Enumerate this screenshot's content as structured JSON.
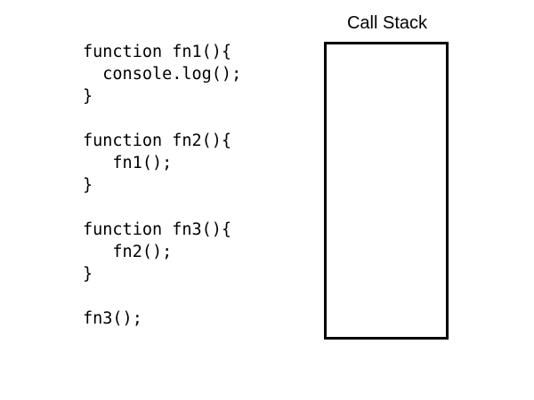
{
  "code": {
    "lines": [
      "function fn1(){",
      "  console.log();",
      "}",
      "",
      "function fn2(){",
      "   fn1();",
      "}",
      "",
      "function fn3(){",
      "   fn2();",
      "}",
      "",
      "fn3();"
    ]
  },
  "call_stack": {
    "title": "Call Stack",
    "frames": []
  }
}
